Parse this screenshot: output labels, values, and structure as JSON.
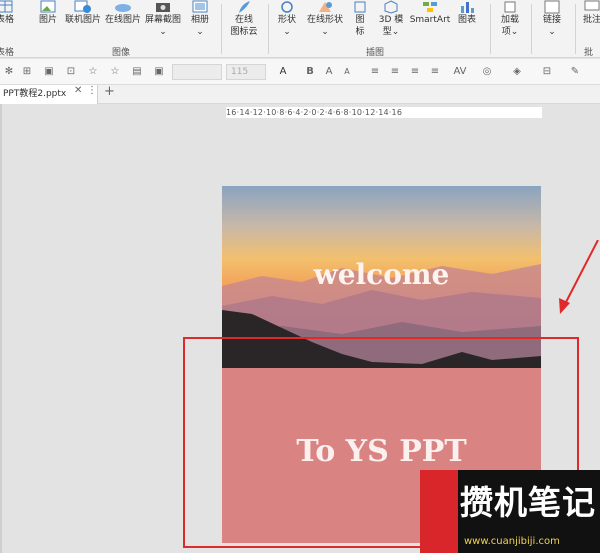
{
  "ribbon": {
    "buttons": [
      {
        "label": "表格",
        "sub": ""
      },
      {
        "label": "图片",
        "sub": ""
      },
      {
        "label": "联机图片",
        "sub": ""
      },
      {
        "label": "在线图片",
        "sub": ""
      },
      {
        "label": "屏幕截图",
        "sub": "⌄"
      },
      {
        "label": "相册",
        "sub": "⌄"
      },
      {
        "label": "在线",
        "sub": "图标云"
      },
      {
        "label": "形状",
        "sub": "⌄"
      },
      {
        "label": "在线形状",
        "sub": "⌄"
      },
      {
        "label": "图",
        "sub": "标"
      },
      {
        "label": "3D 模",
        "sub": "型⌄"
      },
      {
        "label": "SmartArt",
        "sub": ""
      },
      {
        "label": "图表",
        "sub": ""
      },
      {
        "label": "加载",
        "sub": "项⌄"
      },
      {
        "label": "链接",
        "sub": "⌄"
      },
      {
        "label": "批注",
        "sub": ""
      }
    ],
    "groups": {
      "left": "表格",
      "images": "图像",
      "illustrations": "插图",
      "comments": "批注"
    }
  },
  "format_bar": {
    "font_size": "115",
    "letters": [
      "A",
      "B",
      "A",
      "A",
      "AV"
    ]
  },
  "tabs": {
    "doc_name": "PPT教程2.pptx",
    "close": "✕",
    "more": "⋮",
    "add": "+"
  },
  "ruler": {
    "text": "16·14·12·10·8·6·4·2·0·2·4·6·8·10·12·14·16"
  },
  "slide": {
    "title": "welcome",
    "subtitle": "To YS PPT"
  },
  "watermark": {
    "title": "攒机笔记",
    "url": "www.cuanjibiji.com"
  },
  "colors": {
    "annotation_red": "#e02a2a",
    "slide_pink": "#d98383",
    "watermark_yellow": "#f2d34d"
  }
}
